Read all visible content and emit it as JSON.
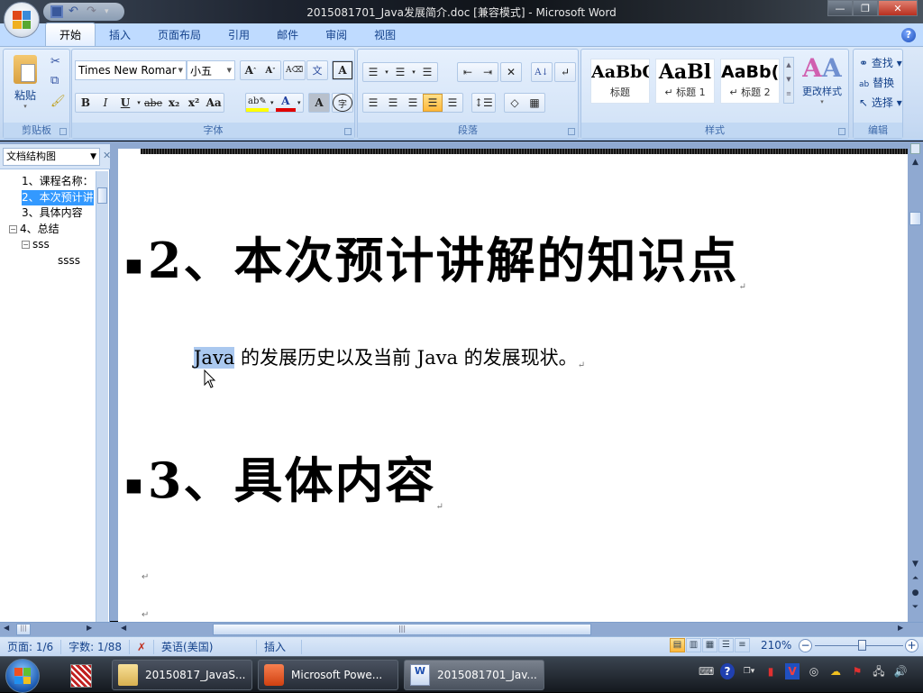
{
  "window": {
    "title": "2015081701_Java发展简介.doc [兼容模式] - Microsoft Word",
    "controls": {
      "minimize": "—",
      "restore": "❐",
      "close": "✕"
    }
  },
  "ribbon_tabs": [
    "开始",
    "插入",
    "页面布局",
    "引用",
    "邮件",
    "审阅",
    "视图"
  ],
  "active_tab": "开始",
  "clipboard": {
    "paste_label": "粘贴",
    "group_label": "剪贴板"
  },
  "font": {
    "font_name": "Times New Romar",
    "font_size": "小五",
    "group_label": "字体",
    "buttons": [
      "B",
      "I",
      "U",
      "abe",
      "x₂",
      "x²",
      "Aa"
    ]
  },
  "paragraph": {
    "group_label": "段落"
  },
  "styles": {
    "items": [
      {
        "preview": "AaBbC",
        "label": "标题"
      },
      {
        "preview": "AaBl",
        "label": "↵ 标题 1"
      },
      {
        "preview": "AaBb(",
        "label": "↵ 标题 2"
      }
    ],
    "change_styles_label": "更改样式",
    "group_label": "样式"
  },
  "editing": {
    "find_label": "查找",
    "replace_label": "替换",
    "select_label": "选择",
    "group_label": "编辑"
  },
  "nav_pane": {
    "dropdown_value": "文档结构图",
    "items": [
      {
        "text": "1、课程名称：",
        "level": 0,
        "selected": false,
        "expander": ""
      },
      {
        "text": "2、本次预计讲",
        "level": 0,
        "selected": true,
        "expander": ""
      },
      {
        "text": "3、具体内容",
        "level": 0,
        "selected": false,
        "expander": ""
      },
      {
        "text": "4、总结",
        "level": 0,
        "selected": false,
        "expander": "⊟"
      },
      {
        "text": "sss",
        "level": 1,
        "selected": false,
        "expander": "⊟"
      },
      {
        "text": "ssss",
        "level": 2,
        "selected": false,
        "expander": ""
      }
    ]
  },
  "document": {
    "heading2": "2、本次预计讲解的知识点",
    "body_highlight": "Java",
    "body_rest": " 的发展历史以及当前 Java 的发展现状。",
    "heading3": "3、具体内容",
    "paragraph_mark": "↵",
    "bullet": "■"
  },
  "statusbar": {
    "page": "页面: 1/6",
    "words": "字数: 1/88",
    "language": "英语(美国)",
    "mode": "插入",
    "zoom": "210%",
    "zoom_fraction": 0.53
  },
  "taskbar": {
    "tasks": [
      {
        "label": "20150817_JavaS...",
        "icon": "folder-icon"
      },
      {
        "label": "Microsoft Powe...",
        "icon": "powerpoint-icon"
      },
      {
        "label": "2015081701_Jav...",
        "icon": "word-icon"
      }
    ]
  }
}
